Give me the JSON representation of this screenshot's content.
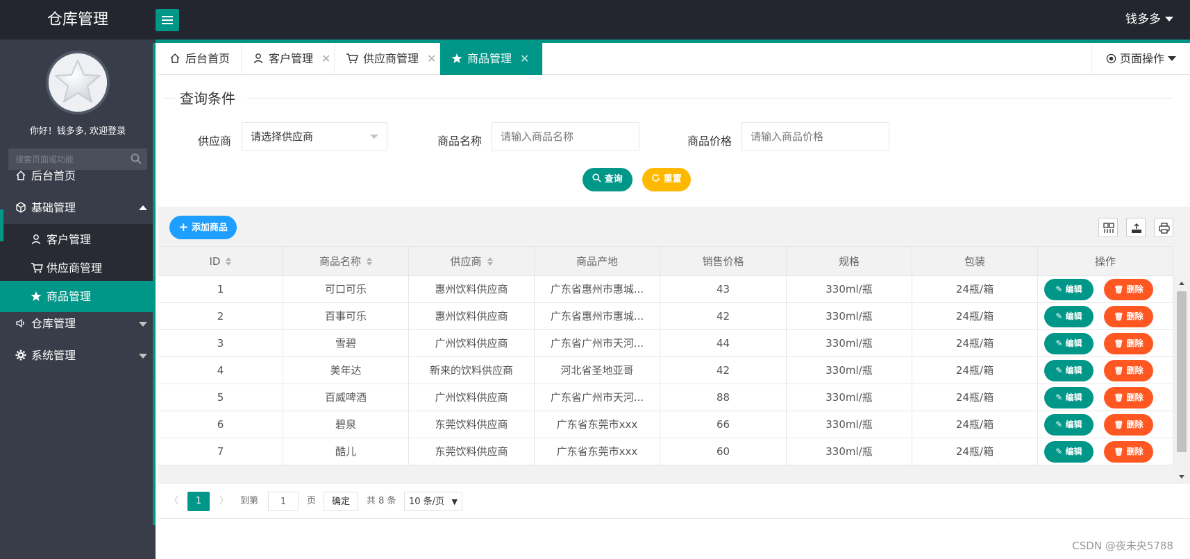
{
  "app": {
    "title": "仓库管理",
    "user_name": "钱多多"
  },
  "sidebar": {
    "welcome": "你好！钱多多, 欢迎登录",
    "search_placeholder": "搜索页面或功能",
    "items": [
      {
        "label": "后台首页",
        "icon": "home-icon"
      },
      {
        "label": "基础管理",
        "icon": "cube-icon",
        "expanded": true,
        "children": [
          {
            "label": "客户管理",
            "icon": "user-icon"
          },
          {
            "label": "供应商管理",
            "icon": "cart-icon"
          },
          {
            "label": "商品管理",
            "icon": "star-icon",
            "active": true
          }
        ]
      },
      {
        "label": "仓库管理",
        "icon": "speaker-icon"
      },
      {
        "label": "系统管理",
        "icon": "gear-icon"
      }
    ]
  },
  "tabs": [
    {
      "label": "后台首页",
      "icon": "home-icon",
      "closable": false
    },
    {
      "label": "客户管理",
      "icon": "user-icon",
      "closable": true
    },
    {
      "label": "供应商管理",
      "icon": "cart-icon",
      "closable": true
    },
    {
      "label": "商品管理",
      "icon": "star-icon",
      "closable": true,
      "active": true
    }
  ],
  "page_ops": "页面操作",
  "query": {
    "legend": "查询条件",
    "supplier_label": "供应商",
    "supplier_value": "请选择供应商",
    "name_label": "商品名称",
    "name_placeholder": "请输入商品名称",
    "price_label": "商品价格",
    "price_placeholder": "请输入商品价格",
    "search_btn": "查询",
    "reset_btn": "重置"
  },
  "toolbar": {
    "add_btn": "添加商品"
  },
  "table": {
    "columns": [
      "ID",
      "商品名称",
      "供应商",
      "商品产地",
      "销售价格",
      "规格",
      "包装",
      "操作"
    ],
    "edit_label": "编辑",
    "delete_label": "删除",
    "rows": [
      [
        "1",
        "可口可乐",
        "惠州饮料供应商",
        "广东省惠州市惠城...",
        "43",
        "330ml/瓶",
        "24瓶/箱"
      ],
      [
        "2",
        "百事可乐",
        "惠州饮料供应商",
        "广东省惠州市惠城...",
        "42",
        "330ml/瓶",
        "24瓶/箱"
      ],
      [
        "3",
        "雪碧",
        "广州饮料供应商",
        "广东省广州市天河...",
        "44",
        "330ml/瓶",
        "24瓶/箱"
      ],
      [
        "4",
        "美年达",
        "新来的饮料供应商",
        "河北省圣地亚哥",
        "42",
        "330ml/瓶",
        "24瓶/箱"
      ],
      [
        "5",
        "百威啤酒",
        "广州饮料供应商",
        "广东省广州市天河...",
        "88",
        "330ml/瓶",
        "24瓶/箱"
      ],
      [
        "6",
        "碧泉",
        "东莞饮料供应商",
        "广东省东莞市xxx",
        "66",
        "330ml/瓶",
        "24瓶/箱"
      ],
      [
        "7",
        "酷儿",
        "东莞饮料供应商",
        "广东省东莞市xxx",
        "60",
        "330ml/瓶",
        "24瓶/箱"
      ]
    ]
  },
  "pager": {
    "current": "1",
    "goto_label": "到第",
    "goto_value": "1",
    "page_unit": "页",
    "confirm": "确定",
    "total": "共 8 条",
    "page_size": "10 条/页"
  },
  "watermark": "CSDN @夜未央5788",
  "colors": {
    "primary": "#009688",
    "danger": "#ff5722",
    "warn": "#ffb800",
    "info": "#1e9fff",
    "header": "#23262e",
    "sidebar": "#393d49"
  }
}
